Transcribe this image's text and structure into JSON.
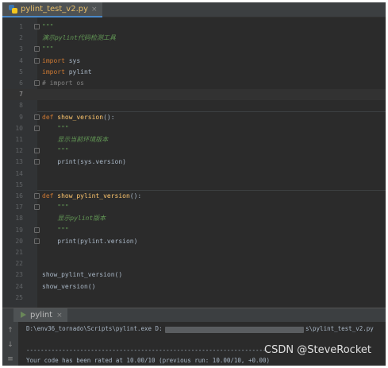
{
  "editor": {
    "tab_label": "pylint_test_v2.py",
    "tab_close": "×",
    "current_line": 7,
    "lines": [
      {
        "n": "1",
        "text": "\"\"\"",
        "cls": "docq",
        "fold": true
      },
      {
        "n": "2",
        "text": "演示pylint代码检测工具",
        "cls": "doc"
      },
      {
        "n": "3",
        "text": "\"\"\"",
        "cls": "docq",
        "fold": true
      },
      {
        "n": "4",
        "kw": "import",
        "rest": " sys",
        "fold": true
      },
      {
        "n": "5",
        "kw": "import",
        "rest": " pylint"
      },
      {
        "n": "6",
        "text": "# import os",
        "cls": "cm",
        "fold": true
      },
      {
        "n": "7",
        "text": ""
      },
      {
        "n": "8",
        "text": ""
      },
      {
        "n": "9",
        "kw": "def",
        "fname": " show_version",
        "rest": "():",
        "fold": true
      },
      {
        "n": "10",
        "text": "    \"\"\"",
        "cls": "docq",
        "fold": true
      },
      {
        "n": "11",
        "text": "    显示当前环境版本",
        "cls": "doc"
      },
      {
        "n": "12",
        "text": "    \"\"\"",
        "cls": "docq",
        "fold": true
      },
      {
        "n": "13",
        "text": "    print(sys.version)",
        "cls": "plain",
        "fold": true
      },
      {
        "n": "14",
        "text": ""
      },
      {
        "n": "15",
        "text": ""
      },
      {
        "n": "16",
        "kw": "def",
        "fname": " show_pylint_version",
        "rest": "():",
        "fold": true
      },
      {
        "n": "17",
        "text": "    \"\"\"",
        "cls": "docq",
        "fold": true
      },
      {
        "n": "18",
        "text": "    显示pylint版本",
        "cls": "doc"
      },
      {
        "n": "19",
        "text": "    \"\"\"",
        "cls": "docq",
        "fold": true
      },
      {
        "n": "20",
        "text": "    print(pylint.version)",
        "cls": "plain",
        "fold": true
      },
      {
        "n": "21",
        "text": ""
      },
      {
        "n": "22",
        "text": ""
      },
      {
        "n": "23",
        "text": "show_pylint_version()",
        "cls": "plain"
      },
      {
        "n": "24",
        "text": "show_version()",
        "cls": "plain"
      },
      {
        "n": "25",
        "text": ""
      }
    ]
  },
  "run_panel": {
    "tab_label": "pylint",
    "tab_close": "×",
    "cmd_prefix": "D:\\env36_tornado\\Scripts\\pylint.exe D:",
    "cmd_suffix": "s\\pylint_test_v2.py",
    "divider": "-------------------------------------------------------------------",
    "rating": "Your code has been rated at 10.00/10 (previous run: 10.00/10, +0.00)",
    "side_icons": [
      "up-arrow-icon",
      "down-arrow-icon",
      "wrap-icon"
    ]
  },
  "watermark": "CSDN @SteveRocket"
}
